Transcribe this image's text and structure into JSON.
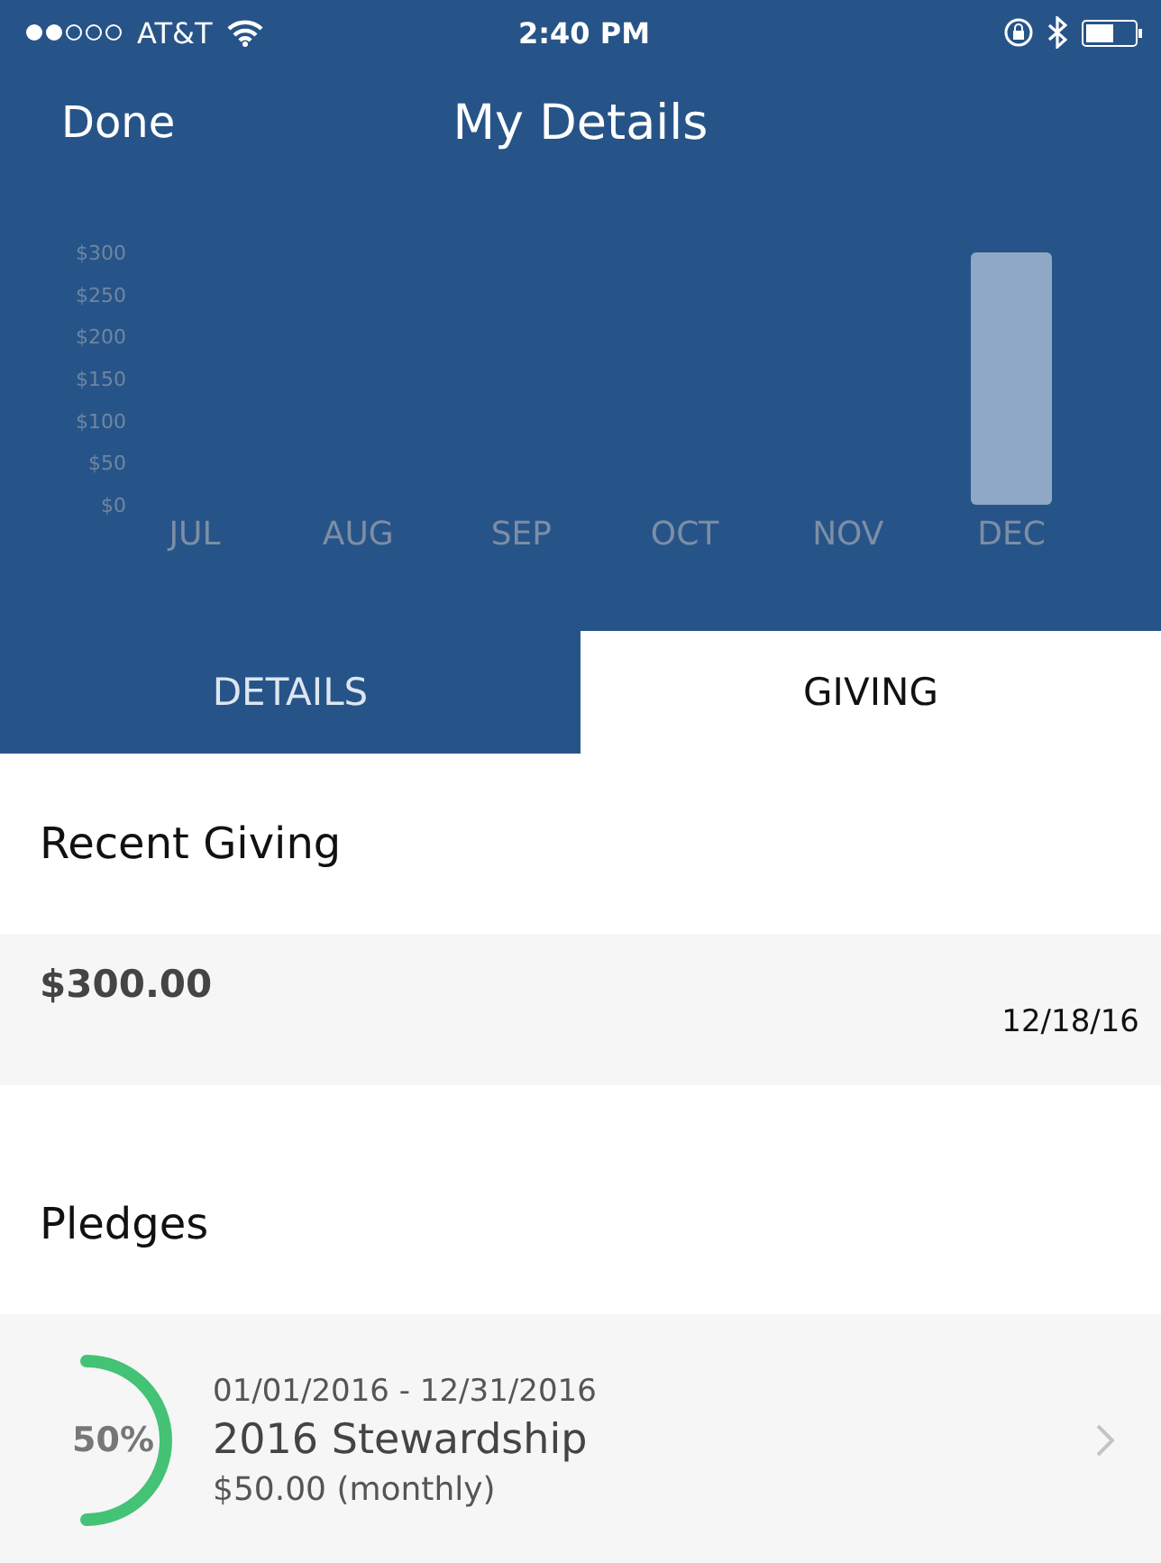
{
  "status_bar": {
    "carrier": "AT&T",
    "time": "2:40 PM"
  },
  "nav": {
    "left": "Done",
    "title": "My Details"
  },
  "chart_data": {
    "type": "bar",
    "categories": [
      "JUL",
      "AUG",
      "SEP",
      "OCT",
      "NOV",
      "DEC"
    ],
    "series": [
      {
        "color": "#8fa8c6",
        "values": [
          0,
          0,
          0,
          0,
          0,
          300
        ]
      }
    ],
    "ylim": [
      0,
      300
    ],
    "yticks": [
      {
        "value": 0,
        "label": "$0"
      },
      {
        "value": 50,
        "label": "$50"
      },
      {
        "value": 100,
        "label": "$100"
      },
      {
        "value": 150,
        "label": "$150"
      },
      {
        "value": 200,
        "label": "$200"
      },
      {
        "value": 250,
        "label": "$250"
      },
      {
        "value": 300,
        "label": "$300"
      }
    ]
  },
  "tabs": [
    {
      "label": "DETAILS",
      "selected": false
    },
    {
      "label": "GIVING",
      "selected": true
    }
  ],
  "recent_giving": {
    "title": "Recent Giving",
    "items": [
      {
        "amount": "$300.00",
        "date": "12/18/16"
      }
    ]
  },
  "pledges": {
    "title": "Pledges",
    "items": [
      {
        "percent": "50%",
        "period": "01/01/2016 - 12/31/2016",
        "name": "2016 Stewardship",
        "amount": "$50.00 (monthly)"
      }
    ]
  }
}
